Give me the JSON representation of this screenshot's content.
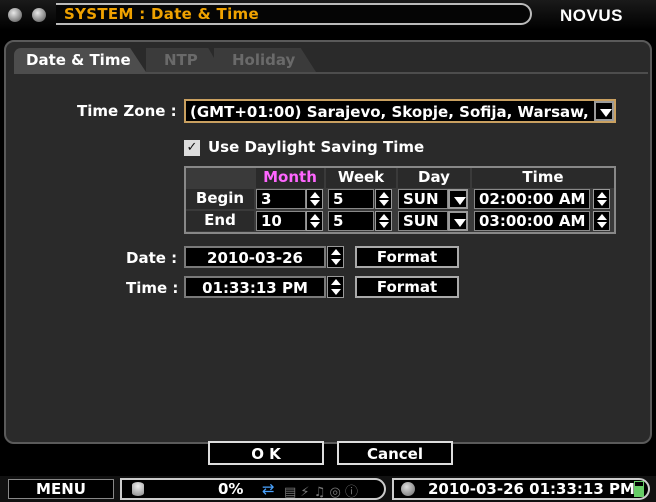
{
  "window": {
    "title": "SYSTEM : Date & Time",
    "brand": "NOVUS"
  },
  "tabs": [
    {
      "label": "Date & Time",
      "active": true
    },
    {
      "label": "NTP",
      "active": false
    },
    {
      "label": "Holiday",
      "active": false
    }
  ],
  "time_zone": {
    "label": "Time Zone :",
    "value": "(GMT+01:00) Sarajevo, Skopje, Sofija, Warsaw,"
  },
  "dst": {
    "checkbox_label": "Use Daylight Saving Time",
    "checked": true,
    "check_mark": "✓",
    "headers": [
      "Month",
      "Week",
      "Day",
      "Time"
    ],
    "rows": [
      {
        "label": "Begin",
        "month": "3",
        "week": "5",
        "day": "SUN",
        "time": "02:00:00 AM"
      },
      {
        "label": "End",
        "month": "10",
        "week": "5",
        "day": "SUN",
        "time": "03:00:00 AM"
      }
    ]
  },
  "date": {
    "label": "Date :",
    "value": "2010-03-26",
    "format_label": "Format"
  },
  "time": {
    "label": "Time :",
    "value": "01:33:13 PM",
    "format_label": "Format"
  },
  "buttons": {
    "ok": "O K",
    "cancel": "Cancel"
  },
  "statusbar": {
    "menu": "MENU",
    "disk_usage": "0%",
    "datetime": "2010-03-26 01:33:13 PM"
  },
  "colors": {
    "title": "#f0a200",
    "month_header": "#ff66ff",
    "week_header": "#ffffff"
  }
}
